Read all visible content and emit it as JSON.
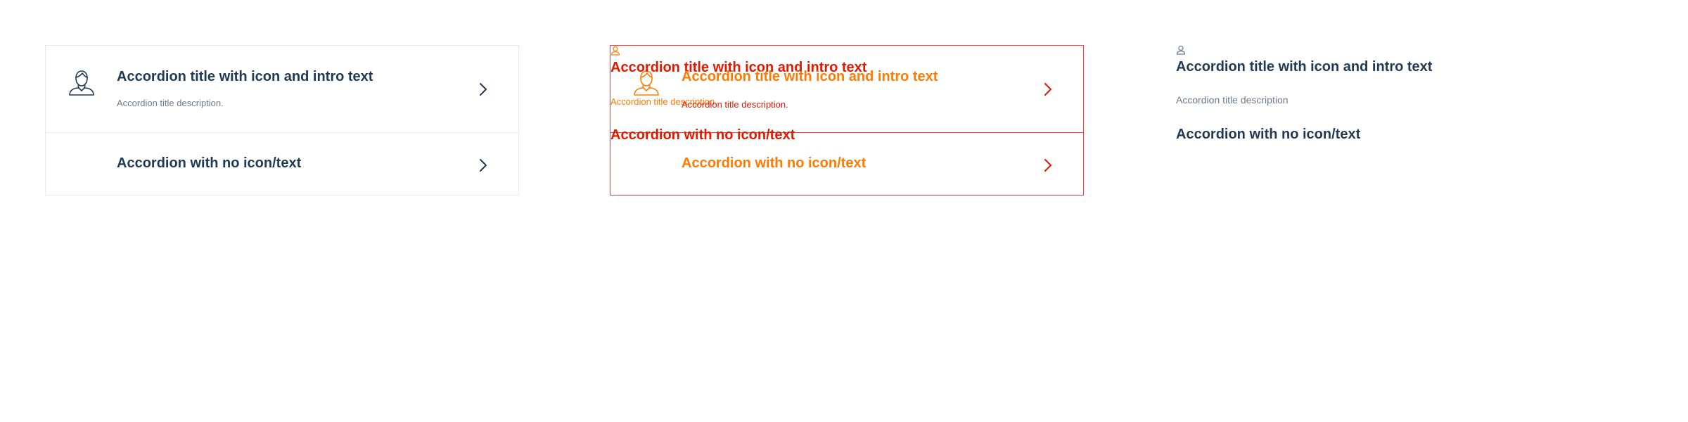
{
  "colors": {
    "title": "#1e3a55",
    "description": "#6b7b8c",
    "border": "#e6e9ed",
    "debug_red": "#e11900",
    "debug_orange": "#ff7a00"
  },
  "accordion": {
    "items": [
      {
        "title": "Accordion title with icon and intro text",
        "description": "Accordion title description.",
        "icon": "user-icon"
      },
      {
        "title": "Accordion with no icon/text"
      }
    ]
  },
  "debug_overlay": {
    "title_1": "Accordion title with icon and intro text",
    "description_1": "Accordion title description.",
    "title_2": "Accordion with no icon/text"
  },
  "plain": {
    "title_1": "Accordion title with icon and intro text",
    "description_1": "Accordion title description",
    "title_2": "Accordion with no icon/text"
  }
}
